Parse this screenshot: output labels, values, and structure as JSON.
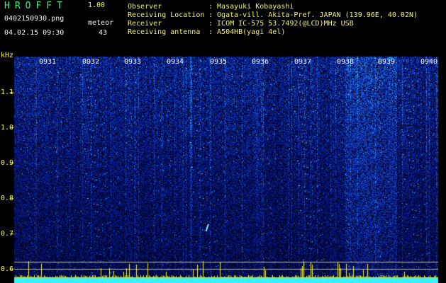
{
  "app": {
    "title": "HROFFT",
    "version": "1.00",
    "filename": "0402150930.png",
    "timestamp": "04.02.15 09:30",
    "meteor_label": "meteor",
    "meteor_count": "43"
  },
  "info": [
    {
      "key": "Observer",
      "value": ": Masayuki Kobayashi"
    },
    {
      "key": "Receiving Location",
      "value": ": Ogata-vill. Akita-Pref. JAPAN (139.96E, 40.02N)"
    },
    {
      "key": "Receiver",
      "value": ": ICOM IC-575 53.7492(@LCD)MHz USB"
    },
    {
      "key": "Receiving antenna",
      "value": ": A504HB(yagi 4el)"
    }
  ],
  "spectrogram": {
    "y_unit": "kHz",
    "y_ticks": [
      "1.1",
      "1.0",
      "0.9",
      "0.8",
      "0.7",
      "0.6"
    ],
    "time_labels": [
      "0931",
      "0932",
      "0933",
      "0934",
      "0935",
      "0936",
      "0937",
      "0938",
      "0939",
      "0940"
    ],
    "colors": {
      "background": "#000000",
      "noise_low": "#0a1a8a",
      "noise_high": "#2a9af0",
      "meteor": "#f4f44a",
      "baseline": "#3af0ff"
    }
  }
}
